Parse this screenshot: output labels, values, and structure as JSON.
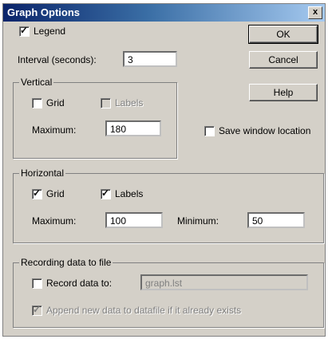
{
  "window": {
    "title": "Graph Options",
    "close_glyph": "x"
  },
  "legend": {
    "label": "Legend",
    "checked": true
  },
  "interval": {
    "label": "Interval (seconds):",
    "value": "3"
  },
  "buttons": {
    "ok": "OK",
    "cancel": "Cancel",
    "help": "Help"
  },
  "save_window": {
    "label": "Save window location",
    "checked": false
  },
  "vertical": {
    "title": "Vertical",
    "grid_label": "Grid",
    "grid_checked": false,
    "labels_label": "Labels",
    "labels_checked": false,
    "labels_disabled": true,
    "maximum_label": "Maximum:",
    "maximum_value": "180"
  },
  "horizontal": {
    "title": "Horizontal",
    "grid_label": "Grid",
    "grid_checked": true,
    "labels_label": "Labels",
    "labels_checked": true,
    "maximum_label": "Maximum:",
    "maximum_value": "100",
    "minimum_label": "Minimum:",
    "minimum_value": "50"
  },
  "recording": {
    "title": "Recording data to file",
    "record_label": "Record data to:",
    "record_checked": false,
    "file_value": "graph.lst",
    "append_label": "Append new data to datafile if it already exists",
    "append_checked": true,
    "append_disabled": true
  }
}
